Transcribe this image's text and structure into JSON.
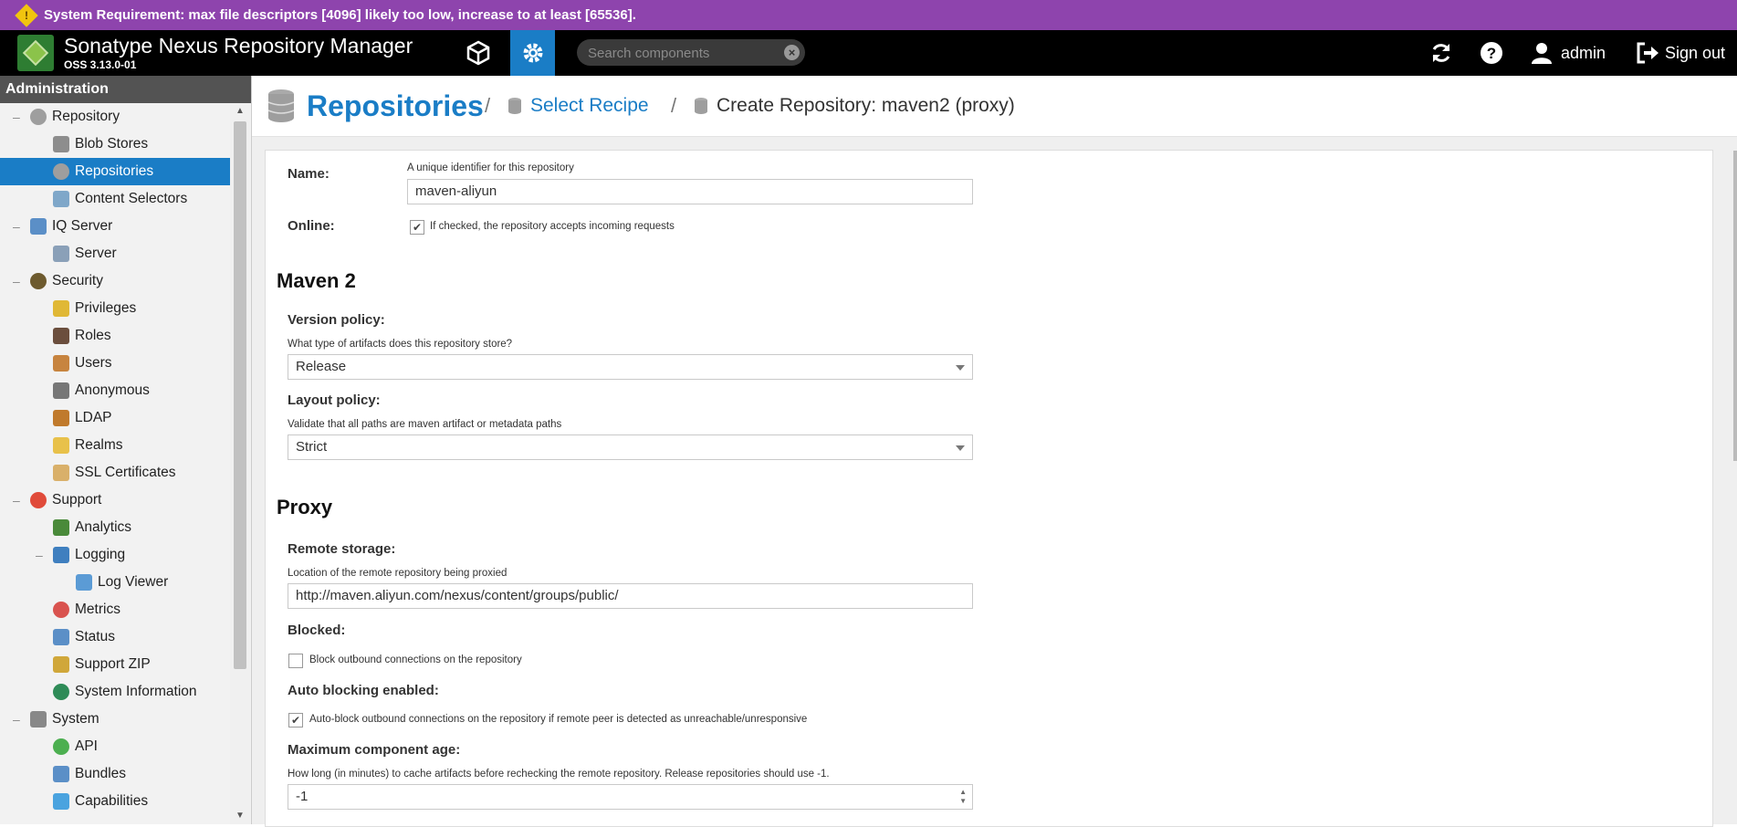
{
  "banner": {
    "text": "System Requirement: max file descriptors [4096] likely too low, increase to at least [65536].",
    "color": "#8e44ad"
  },
  "header": {
    "title": "Sonatype Nexus Repository Manager",
    "version": "OSS 3.13.0-01",
    "search_placeholder": "Search components",
    "user": "admin",
    "signout": "Sign out",
    "accent": "#1a7dc6"
  },
  "sidebar": {
    "title": "Administration",
    "items": [
      {
        "label": "Repository",
        "toggle": "–",
        "icon": "database-icon",
        "level": 0
      },
      {
        "label": "Blob Stores",
        "icon": "blob-store-icon",
        "level": 1
      },
      {
        "label": "Repositories",
        "icon": "database-icon",
        "level": 1,
        "selected": true
      },
      {
        "label": "Content Selectors",
        "icon": "content-selector-icon",
        "level": 1
      },
      {
        "label": "IQ Server",
        "toggle": "–",
        "icon": "iq-server-icon",
        "level": 0
      },
      {
        "label": "Server",
        "icon": "server-icon",
        "level": 1
      },
      {
        "label": "Security",
        "toggle": "–",
        "icon": "security-icon",
        "level": 0
      },
      {
        "label": "Privileges",
        "icon": "medal-icon",
        "level": 1
      },
      {
        "label": "Roles",
        "icon": "role-icon",
        "level": 1
      },
      {
        "label": "Users",
        "icon": "users-icon",
        "level": 1
      },
      {
        "label": "Anonymous",
        "icon": "anonymous-icon",
        "level": 1
      },
      {
        "label": "LDAP",
        "icon": "book-icon",
        "level": 1
      },
      {
        "label": "Realms",
        "icon": "shield-icon",
        "level": 1
      },
      {
        "label": "SSL Certificates",
        "icon": "certificate-icon",
        "level": 1
      },
      {
        "label": "Support",
        "toggle": "–",
        "icon": "lifebuoy-icon",
        "level": 0
      },
      {
        "label": "Analytics",
        "icon": "analytics-icon",
        "level": 1
      },
      {
        "label": "Logging",
        "toggle": "–",
        "icon": "logging-icon",
        "level": 1
      },
      {
        "label": "Log Viewer",
        "icon": "scroll-icon",
        "level": 2
      },
      {
        "label": "Metrics",
        "icon": "pie-chart-icon",
        "level": 1
      },
      {
        "label": "Status",
        "icon": "bar-chart-icon",
        "level": 1
      },
      {
        "label": "Support ZIP",
        "icon": "zip-icon",
        "level": 1
      },
      {
        "label": "System Information",
        "icon": "globe-icon",
        "level": 1
      },
      {
        "label": "System",
        "toggle": "–",
        "icon": "gear-icon",
        "level": 0
      },
      {
        "label": "API",
        "icon": "api-icon",
        "level": 1
      },
      {
        "label": "Bundles",
        "icon": "bundle-icon",
        "level": 1
      },
      {
        "label": "Capabilities",
        "icon": "capability-icon",
        "level": 1
      }
    ]
  },
  "breadcrumb": {
    "root": "Repositories",
    "sep": "/",
    "step": "Select Recipe",
    "current": "Create Repository: maven2 (proxy)"
  },
  "form": {
    "name_label": "Name:",
    "name_help": "A unique identifier for this repository",
    "name_value": "maven-aliyun",
    "online_label": "Online:",
    "online_help": "If checked, the repository accepts incoming requests",
    "online_checked": true,
    "maven_heading": "Maven 2",
    "version_label": "Version policy:",
    "version_help": "What type of artifacts does this repository store?",
    "version_value": "Release",
    "layout_label": "Layout policy:",
    "layout_help": "Validate that all paths are maven artifact or metadata paths",
    "layout_value": "Strict",
    "proxy_heading": "Proxy",
    "remote_label": "Remote storage:",
    "remote_help": "Location of the remote repository being proxied",
    "remote_value": "http://maven.aliyun.com/nexus/content/groups/public/",
    "blocked_label": "Blocked:",
    "blocked_help": "Block outbound connections on the repository",
    "blocked_checked": false,
    "autoblock_label": "Auto blocking enabled:",
    "autoblock_help": "Auto-block outbound connections on the repository if remote peer is detected as unreachable/unresponsive",
    "autoblock_checked": true,
    "maxage_label": "Maximum component age:",
    "maxage_help": "How long (in minutes) to cache artifacts before rechecking the remote repository. Release repositories should use -1.",
    "maxage_value": "-1"
  }
}
